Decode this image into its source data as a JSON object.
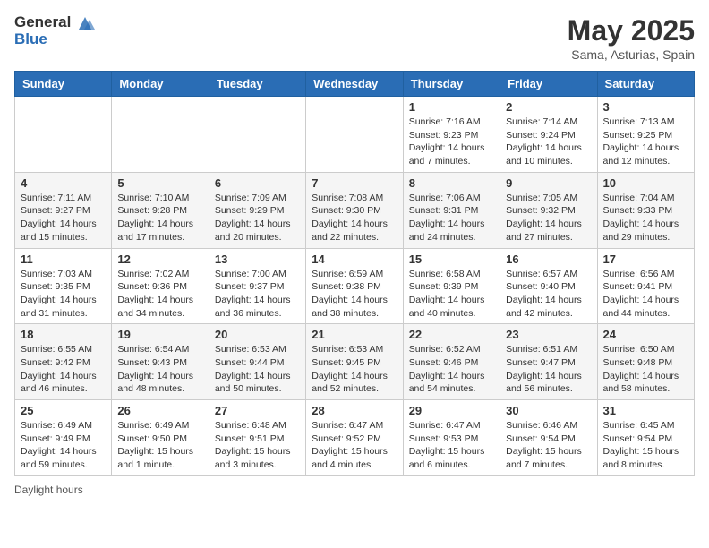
{
  "header": {
    "logo_general": "General",
    "logo_blue": "Blue",
    "month": "May 2025",
    "location": "Sama, Asturias, Spain"
  },
  "days_of_week": [
    "Sunday",
    "Monday",
    "Tuesday",
    "Wednesday",
    "Thursday",
    "Friday",
    "Saturday"
  ],
  "footer_label": "Daylight hours",
  "weeks": [
    [
      {
        "day": "",
        "info": ""
      },
      {
        "day": "",
        "info": ""
      },
      {
        "day": "",
        "info": ""
      },
      {
        "day": "",
        "info": ""
      },
      {
        "day": "1",
        "info": "Sunrise: 7:16 AM\nSunset: 9:23 PM\nDaylight: 14 hours and 7 minutes."
      },
      {
        "day": "2",
        "info": "Sunrise: 7:14 AM\nSunset: 9:24 PM\nDaylight: 14 hours and 10 minutes."
      },
      {
        "day": "3",
        "info": "Sunrise: 7:13 AM\nSunset: 9:25 PM\nDaylight: 14 hours and 12 minutes."
      }
    ],
    [
      {
        "day": "4",
        "info": "Sunrise: 7:11 AM\nSunset: 9:27 PM\nDaylight: 14 hours and 15 minutes."
      },
      {
        "day": "5",
        "info": "Sunrise: 7:10 AM\nSunset: 9:28 PM\nDaylight: 14 hours and 17 minutes."
      },
      {
        "day": "6",
        "info": "Sunrise: 7:09 AM\nSunset: 9:29 PM\nDaylight: 14 hours and 20 minutes."
      },
      {
        "day": "7",
        "info": "Sunrise: 7:08 AM\nSunset: 9:30 PM\nDaylight: 14 hours and 22 minutes."
      },
      {
        "day": "8",
        "info": "Sunrise: 7:06 AM\nSunset: 9:31 PM\nDaylight: 14 hours and 24 minutes."
      },
      {
        "day": "9",
        "info": "Sunrise: 7:05 AM\nSunset: 9:32 PM\nDaylight: 14 hours and 27 minutes."
      },
      {
        "day": "10",
        "info": "Sunrise: 7:04 AM\nSunset: 9:33 PM\nDaylight: 14 hours and 29 minutes."
      }
    ],
    [
      {
        "day": "11",
        "info": "Sunrise: 7:03 AM\nSunset: 9:35 PM\nDaylight: 14 hours and 31 minutes."
      },
      {
        "day": "12",
        "info": "Sunrise: 7:02 AM\nSunset: 9:36 PM\nDaylight: 14 hours and 34 minutes."
      },
      {
        "day": "13",
        "info": "Sunrise: 7:00 AM\nSunset: 9:37 PM\nDaylight: 14 hours and 36 minutes."
      },
      {
        "day": "14",
        "info": "Sunrise: 6:59 AM\nSunset: 9:38 PM\nDaylight: 14 hours and 38 minutes."
      },
      {
        "day": "15",
        "info": "Sunrise: 6:58 AM\nSunset: 9:39 PM\nDaylight: 14 hours and 40 minutes."
      },
      {
        "day": "16",
        "info": "Sunrise: 6:57 AM\nSunset: 9:40 PM\nDaylight: 14 hours and 42 minutes."
      },
      {
        "day": "17",
        "info": "Sunrise: 6:56 AM\nSunset: 9:41 PM\nDaylight: 14 hours and 44 minutes."
      }
    ],
    [
      {
        "day": "18",
        "info": "Sunrise: 6:55 AM\nSunset: 9:42 PM\nDaylight: 14 hours and 46 minutes."
      },
      {
        "day": "19",
        "info": "Sunrise: 6:54 AM\nSunset: 9:43 PM\nDaylight: 14 hours and 48 minutes."
      },
      {
        "day": "20",
        "info": "Sunrise: 6:53 AM\nSunset: 9:44 PM\nDaylight: 14 hours and 50 minutes."
      },
      {
        "day": "21",
        "info": "Sunrise: 6:53 AM\nSunset: 9:45 PM\nDaylight: 14 hours and 52 minutes."
      },
      {
        "day": "22",
        "info": "Sunrise: 6:52 AM\nSunset: 9:46 PM\nDaylight: 14 hours and 54 minutes."
      },
      {
        "day": "23",
        "info": "Sunrise: 6:51 AM\nSunset: 9:47 PM\nDaylight: 14 hours and 56 minutes."
      },
      {
        "day": "24",
        "info": "Sunrise: 6:50 AM\nSunset: 9:48 PM\nDaylight: 14 hours and 58 minutes."
      }
    ],
    [
      {
        "day": "25",
        "info": "Sunrise: 6:49 AM\nSunset: 9:49 PM\nDaylight: 14 hours and 59 minutes."
      },
      {
        "day": "26",
        "info": "Sunrise: 6:49 AM\nSunset: 9:50 PM\nDaylight: 15 hours and 1 minute."
      },
      {
        "day": "27",
        "info": "Sunrise: 6:48 AM\nSunset: 9:51 PM\nDaylight: 15 hours and 3 minutes."
      },
      {
        "day": "28",
        "info": "Sunrise: 6:47 AM\nSunset: 9:52 PM\nDaylight: 15 hours and 4 minutes."
      },
      {
        "day": "29",
        "info": "Sunrise: 6:47 AM\nSunset: 9:53 PM\nDaylight: 15 hours and 6 minutes."
      },
      {
        "day": "30",
        "info": "Sunrise: 6:46 AM\nSunset: 9:54 PM\nDaylight: 15 hours and 7 minutes."
      },
      {
        "day": "31",
        "info": "Sunrise: 6:45 AM\nSunset: 9:54 PM\nDaylight: 15 hours and 8 minutes."
      }
    ]
  ]
}
